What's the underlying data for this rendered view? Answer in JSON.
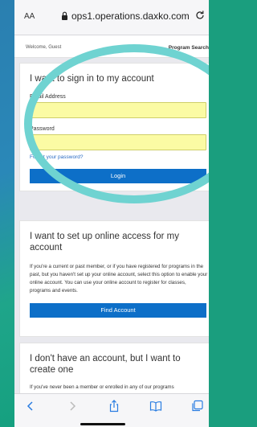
{
  "browser": {
    "text_size_label": "AA",
    "url": "ops1.operations.daxko.com"
  },
  "header": {
    "welcome": "Welcome, Guest",
    "program_search": "Program Search"
  },
  "signin": {
    "title": "I want to sign in to my account",
    "email_label": "Email Address",
    "email_value": "",
    "password_label": "Password",
    "password_value": "",
    "forgot": "Forgot your password?",
    "login_button": "Login"
  },
  "setup": {
    "title": "I want to set up online access for my account",
    "description": "If you're a current or past member, or if you have registered for programs in the past, but you haven't set up your online account, select this option to enable your online account. You can use your online account to register for classes, programs and events.",
    "button": "Find Account"
  },
  "create": {
    "title": "I don't have an account, but I want to create one",
    "description": "If you've never been a member or enrolled in any of our programs"
  },
  "colors": {
    "accent": "#0d6fc8",
    "input_autofill": "#fbfba4",
    "ring": "#6fd3d1",
    "background": "#1a9e7e"
  },
  "toolbar_icons": [
    "back-icon",
    "forward-icon",
    "share-icon",
    "bookmarks-icon",
    "tabs-icon"
  ]
}
